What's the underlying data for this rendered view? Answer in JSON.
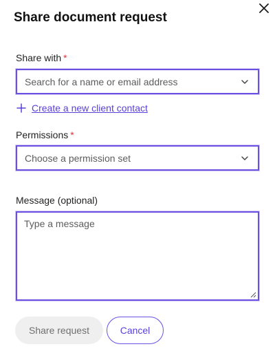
{
  "dialog": {
    "title": "Share document request"
  },
  "share_with": {
    "label": "Share with",
    "required_marker": "*",
    "placeholder": "Search for a name or email address"
  },
  "create_contact": {
    "label": "Create a new client contact"
  },
  "permissions": {
    "label": "Permissions",
    "required_marker": "*",
    "placeholder": "Choose a permission set"
  },
  "message": {
    "label": "Message (optional)",
    "placeholder": "Type a message"
  },
  "actions": {
    "share_label": "Share request",
    "cancel_label": "Cancel"
  },
  "colors": {
    "accent": "#6a4fe0",
    "link": "#5a3fd8",
    "required": "#e0303a",
    "disabled_bg": "#efefef"
  },
  "icons": {
    "close": "close-icon",
    "chevron": "chevron-down-icon",
    "plus": "plus-icon"
  }
}
